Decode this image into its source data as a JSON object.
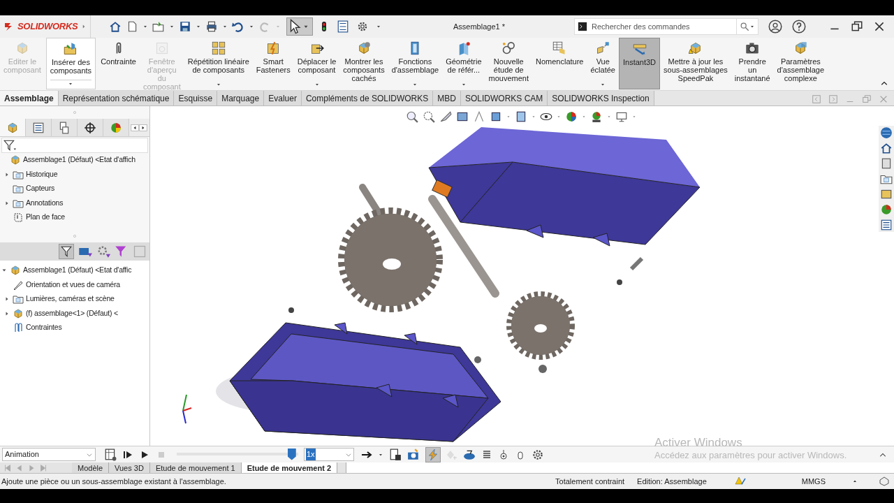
{
  "app": {
    "logo": "SOLIDWORKS",
    "title": "Assemblage1 *",
    "search": {
      "placeholder": "Rechercher des commandes"
    }
  },
  "ribbon": [
    {
      "label": "Editer le\ncomposant",
      "disabled": true,
      "pressed": false,
      "dropdown": false
    },
    {
      "label": "Insérer des\ncomposants",
      "disabled": false,
      "pressed": false,
      "dropdown": true,
      "kind": "split"
    },
    {
      "label": "Contrainte",
      "disabled": false,
      "pressed": false,
      "dropdown": false
    },
    {
      "label": "Fenêtre\nd'aperçu\ndu\ncomposant",
      "disabled": true,
      "pressed": false,
      "dropdown": false
    },
    {
      "label": "Répétition linéaire\nde composants",
      "disabled": false,
      "pressed": false,
      "dropdown": true
    },
    {
      "label": "Smart\nFasteners",
      "disabled": false,
      "pressed": false,
      "dropdown": false
    },
    {
      "label": "Déplacer le\ncomposant",
      "disabled": false,
      "pressed": false,
      "dropdown": true
    },
    {
      "label": "Montrer les\ncomposants\ncachés",
      "disabled": false,
      "pressed": false,
      "dropdown": false
    },
    {
      "label": "Fonctions\nd'assemblage",
      "disabled": false,
      "pressed": false,
      "dropdown": true
    },
    {
      "label": "Géométrie\nde référ...",
      "disabled": false,
      "pressed": false,
      "dropdown": true
    },
    {
      "label": "Nouvelle\nétude de\nmouvement",
      "disabled": false,
      "pressed": false,
      "dropdown": false
    },
    {
      "label": "Nomenclature",
      "disabled": false,
      "pressed": false,
      "dropdown": false
    },
    {
      "label": "Vue\néclatée",
      "disabled": false,
      "pressed": false,
      "dropdown": true
    },
    {
      "label": "Instant3D",
      "disabled": false,
      "pressed": true,
      "dropdown": false
    },
    {
      "label": "Mettre à jour les\nsous-assemblages\nSpeedPak",
      "disabled": false,
      "pressed": false,
      "dropdown": false
    },
    {
      "label": "Prendre\nun\ninstantané",
      "disabled": false,
      "pressed": false,
      "dropdown": false
    },
    {
      "label": "Paramètres\nd'assemblage\ncomplexe",
      "disabled": false,
      "pressed": false,
      "dropdown": false
    }
  ],
  "tabs": [
    {
      "label": "Assemblage",
      "selected": true
    },
    {
      "label": "Représentation schématique",
      "selected": false
    },
    {
      "label": "Esquisse",
      "selected": false
    },
    {
      "label": "Marquage",
      "selected": false
    },
    {
      "label": "Evaluer",
      "selected": false
    },
    {
      "label": "Compléments de SOLIDWORKS",
      "selected": false
    },
    {
      "label": "MBD",
      "selected": false
    },
    {
      "label": "SOLIDWORKS CAM",
      "selected": false
    },
    {
      "label": "SOLIDWORKS Inspection",
      "selected": false
    }
  ],
  "feature_tree": [
    {
      "label": "Assemblage1 (Défaut) <Etat d'affich",
      "kind": "assembly",
      "children": [
        {
          "label": "Historique",
          "kind": "folder",
          "expanded": false
        },
        {
          "label": "Capteurs",
          "kind": "folder"
        },
        {
          "label": "Annotations",
          "kind": "folder",
          "expanded": false
        },
        {
          "label": "Plan de face",
          "kind": "plane"
        }
      ]
    }
  ],
  "motion_tree": [
    {
      "label": "Assemblage1 (Défaut) <Etat d'affic",
      "kind": "assembly",
      "expanded": true,
      "children": [
        {
          "label": "Orientation et vues de caméra",
          "kind": "camera"
        },
        {
          "label": "Lumières, caméras et scène",
          "kind": "folder",
          "expanded": false
        },
        {
          "label": "(f) assemblage<1> (Défaut) <",
          "kind": "assembly",
          "expanded": false
        },
        {
          "label": "Contraintes",
          "kind": "mates"
        }
      ]
    }
  ],
  "animation_bar": {
    "study_type": "Animation",
    "timeline": {
      "level": 0.98
    },
    "speed": "1x"
  },
  "motion_tabs": [
    {
      "label": "Modèle",
      "selected": false
    },
    {
      "label": "Vues 3D",
      "selected": false
    },
    {
      "label": "Etude de mouvement 1",
      "selected": false
    },
    {
      "label": "Etude de mouvement 2",
      "selected": true
    }
  ],
  "os_notice": {
    "title": "Activer Windows",
    "text": "Accédez aux paramètres pour activer Windows."
  },
  "status_bar": {
    "message": "Ajoute une pièce ou un sous-assemblage existant à l'assemblage.",
    "constraint": "Totalement contraint",
    "mode": "Edition: Assemblage",
    "units": "MMGS"
  }
}
